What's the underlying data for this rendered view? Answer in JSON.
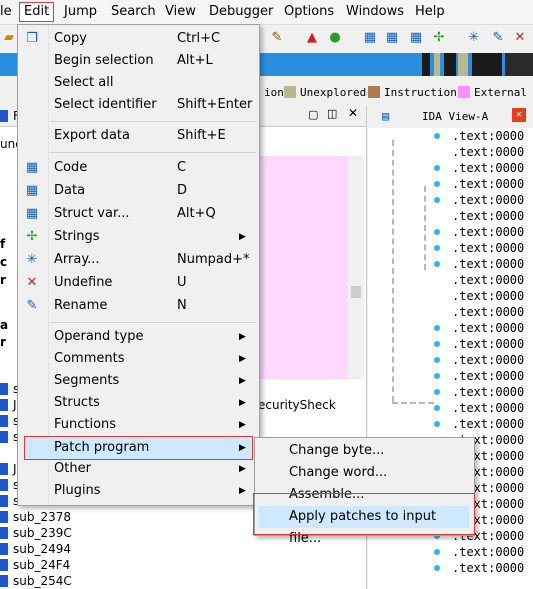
{
  "menubar": {
    "items": [
      "le",
      "Edit",
      "Jump",
      "Search",
      "View",
      "Debugger",
      "Options",
      "Windows",
      "Help"
    ],
    "active": "Edit"
  },
  "legend": {
    "items": [
      {
        "label": "ion",
        "color": "#c8c8c8"
      },
      {
        "label": "Unexplored",
        "color": "#b8b88a"
      },
      {
        "label": "Instruction",
        "color": "#b07850"
      },
      {
        "label": "External s",
        "color": "#ff90ff"
      }
    ]
  },
  "left_pane": {
    "fragments": [
      "Fu",
      "unc",
      "f",
      "c",
      "r",
      "a",
      "r",
      "s",
      "J",
      "s",
      "s",
      "J",
      "s",
      "s"
    ],
    "text_right": "ecuritySheck",
    "list": [
      "sub_2378",
      "sub_239C",
      "sub_2494",
      "sub_24F4",
      "sub_254C"
    ]
  },
  "ida_view": {
    "title": "IDA View-A",
    "row_text": ".text:0000",
    "row_count": 28
  },
  "edit_menu": {
    "items": [
      {
        "label": "Copy",
        "shortcut": "Ctrl+C",
        "icon": "copy-icon"
      },
      {
        "label": "Begin selection",
        "shortcut": "Alt+L"
      },
      {
        "label": "Select all",
        "shortcut": ""
      },
      {
        "label": "Select identifier",
        "shortcut": "Shift+Enter"
      },
      {
        "label": "Export data",
        "shortcut": "Shift+E"
      },
      {
        "label": "Code",
        "shortcut": "C",
        "icon": "code-icon"
      },
      {
        "label": "Data",
        "shortcut": "D",
        "icon": "data-icon"
      },
      {
        "label": "Struct var...",
        "shortcut": "Alt+Q",
        "icon": "struct-icon"
      },
      {
        "label": "Strings",
        "shortcut": "",
        "icon": "strings-icon",
        "submenu": true
      },
      {
        "label": "Array...",
        "shortcut": "Numpad+*",
        "icon": "array-icon"
      },
      {
        "label": "Undefine",
        "shortcut": "U",
        "icon": "undefine-icon"
      },
      {
        "label": "Rename",
        "shortcut": "N",
        "icon": "rename-icon"
      },
      {
        "label": "Operand type",
        "submenu": true
      },
      {
        "label": "Comments",
        "submenu": true
      },
      {
        "label": "Segments",
        "submenu": true
      },
      {
        "label": "Structs",
        "submenu": true
      },
      {
        "label": "Functions",
        "submenu": true
      },
      {
        "label": "Patch program",
        "submenu": true,
        "highlighted": true
      },
      {
        "label": "Other",
        "submenu": true
      },
      {
        "label": "Plugins",
        "submenu": true
      }
    ]
  },
  "patch_submenu": {
    "items": [
      {
        "label": "Change byte..."
      },
      {
        "label": "Change word..."
      },
      {
        "label": "Assemble..."
      },
      {
        "label": "Apply patches to input file...",
        "highlighted": true
      }
    ]
  }
}
